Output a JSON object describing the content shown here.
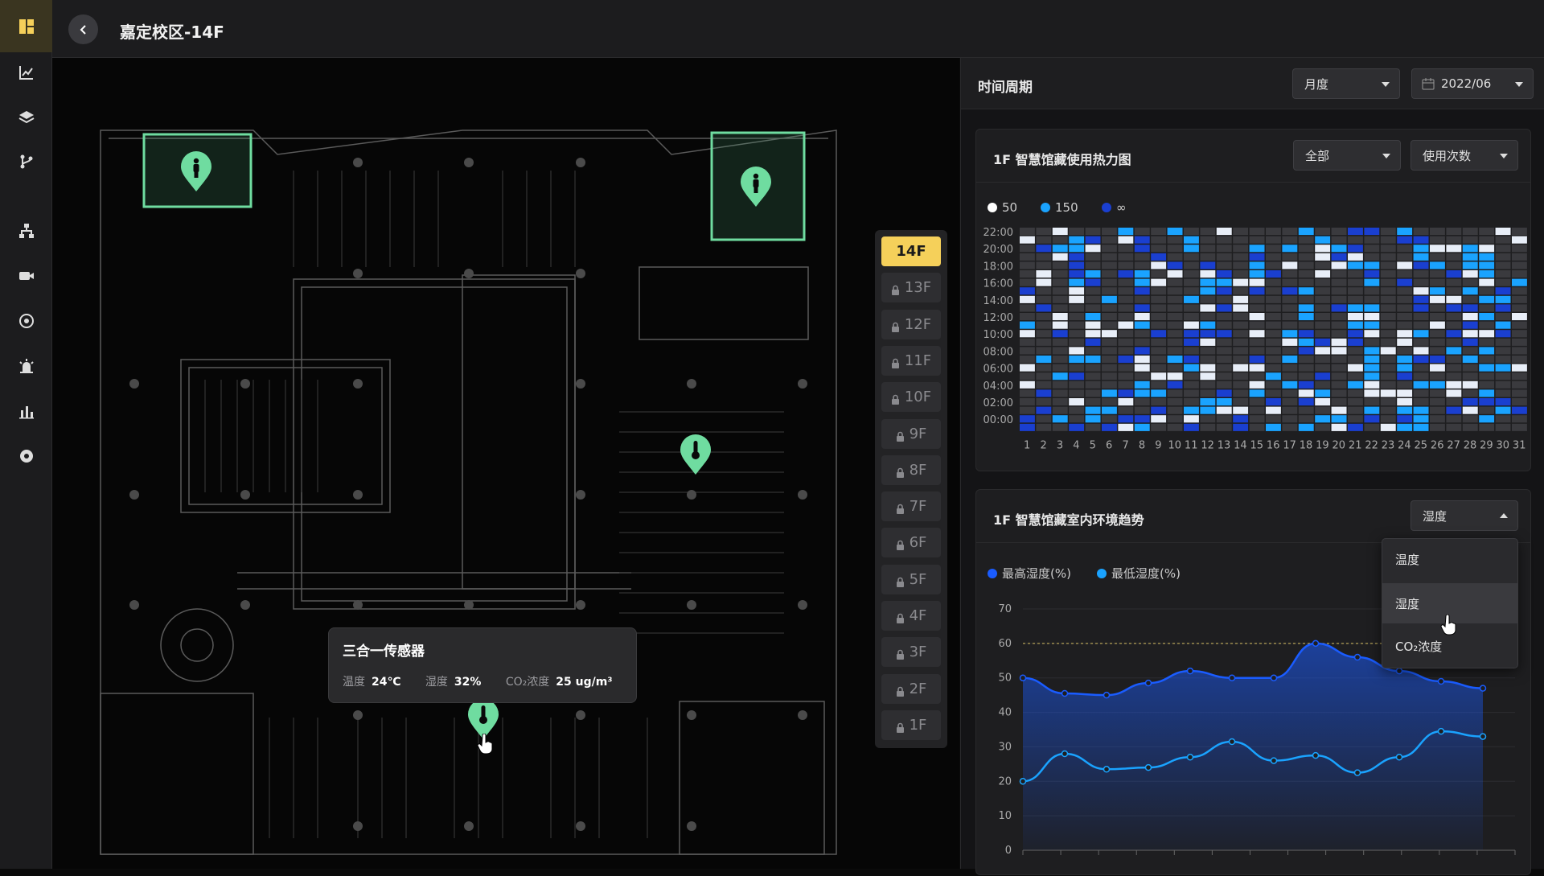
{
  "header": {
    "title": "嘉定校区-14F"
  },
  "sidebar": {
    "icons": [
      "dashboard-icon",
      "line-chart-icon",
      "layers-icon",
      "branch-icon",
      "org-tree-icon",
      "camera-icon",
      "sensor-icon",
      "alarm-icon",
      "bar-chart-icon",
      "settings-icon"
    ]
  },
  "floors": {
    "active": "14F",
    "items": [
      "14F",
      "13F",
      "12F",
      "11F",
      "10F",
      "9F",
      "8F",
      "7F",
      "6F",
      "5F",
      "4F",
      "3F",
      "2F",
      "1F"
    ]
  },
  "sensor_tooltip": {
    "title": "三合一传感器",
    "temp_label": "温度",
    "temp_value": "24℃",
    "humidity_label": "湿度",
    "humidity_value": "32%",
    "co2_label": "CO₂浓度",
    "co2_value": "25 ug/m³"
  },
  "period": {
    "title": "时间周期",
    "cycle": "月度",
    "date": "2022/06"
  },
  "heatmap": {
    "title": "1F 智慧馆藏使用热力图",
    "filter_area": "全部",
    "filter_metric": "使用次数",
    "legend": [
      {
        "label": "50",
        "color": "#ffffff"
      },
      {
        "label": "150",
        "color": "#1aa3ff"
      },
      {
        "label": "∞",
        "color": "#1a3fd0"
      }
    ],
    "y_labels": [
      "22:00",
      "20:00",
      "18:00",
      "16:00",
      "14:00",
      "12:00",
      "10:00",
      "08:00",
      "06:00",
      "04:00",
      "02:00",
      "00:00"
    ],
    "x_labels": [
      "1",
      "2",
      "3",
      "4",
      "5",
      "6",
      "7",
      "8",
      "9",
      "10",
      "11",
      "12",
      "13",
      "14",
      "15",
      "16",
      "17",
      "18",
      "19",
      "20",
      "21",
      "22",
      "23",
      "24",
      "25",
      "26",
      "27",
      "28",
      "29",
      "30",
      "31"
    ]
  },
  "trend": {
    "title": "1F 智慧馆藏室内环境趋势",
    "metric": "湿度",
    "options": [
      "温度",
      "湿度",
      "CO₂浓度"
    ],
    "hovered_option": "湿度"
  },
  "chart_data": {
    "type": "line",
    "title": "1F 智慧馆藏室内环境趋势",
    "ylim": [
      0,
      70
    ],
    "y_ticks": [
      "70",
      "60",
      "50",
      "40",
      "30",
      "20",
      "10",
      "0"
    ],
    "threshold": 60,
    "series": [
      {
        "name": "最高湿度(%)",
        "color": "#1a5cff",
        "values": [
          50,
          45.5,
          45,
          48.5,
          52,
          50,
          50,
          60,
          56,
          52,
          49,
          47
        ]
      },
      {
        "name": "最低湿度(%)",
        "color": "#1aa3ff",
        "values": [
          20,
          28,
          23.5,
          24,
          27,
          31.5,
          26,
          27.5,
          22.5,
          27,
          34.5,
          33
        ]
      }
    ],
    "grid": true,
    "legend_position": "top-left"
  }
}
